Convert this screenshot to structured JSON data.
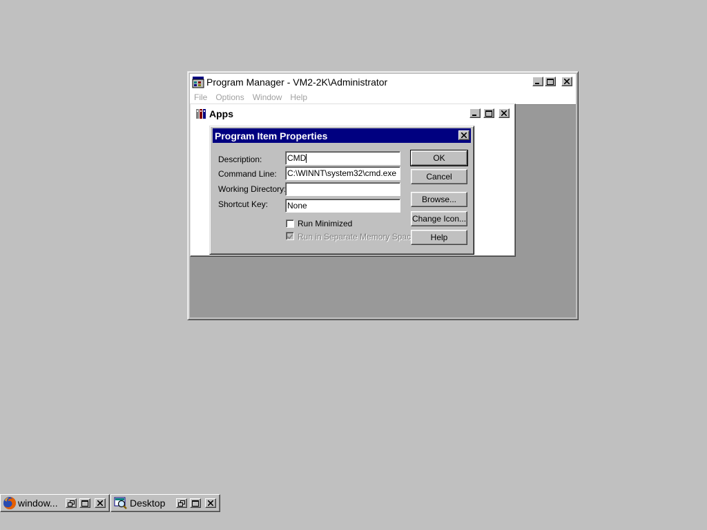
{
  "program_manager": {
    "title": "Program Manager - VM2-2K\\Administrator",
    "menu": [
      "File",
      "Options",
      "Window",
      "Help"
    ]
  },
  "apps_group": {
    "title": "Apps"
  },
  "dialog": {
    "title": "Program Item Properties",
    "fields": {
      "description": {
        "label": "Description:",
        "value": "CMD"
      },
      "command_line": {
        "label": "Command Line:",
        "value": "C:\\WINNT\\system32\\cmd.exe"
      },
      "working_directory": {
        "label": "Working Directory:",
        "value": ""
      },
      "shortcut_key": {
        "label": "Shortcut Key:",
        "value": "None"
      }
    },
    "checkboxes": {
      "run_minimized": {
        "label": "Run Minimized",
        "checked": false
      },
      "run_separate": {
        "label": "Run in Separate Memory Space",
        "checked": true,
        "disabled": true
      }
    },
    "buttons": {
      "ok": "OK",
      "cancel": "Cancel",
      "browse": "Browse...",
      "change_icon": "Change Icon...",
      "help": "Help"
    }
  },
  "taskbar": {
    "items": [
      {
        "label": "window...",
        "icon": "firefox-icon"
      },
      {
        "label": "Desktop",
        "icon": "desktop-search-icon"
      }
    ]
  },
  "colors": {
    "desktop": "#c0c0c0",
    "dialog_title_bar": "#000080",
    "mdi_background": "#999999"
  }
}
